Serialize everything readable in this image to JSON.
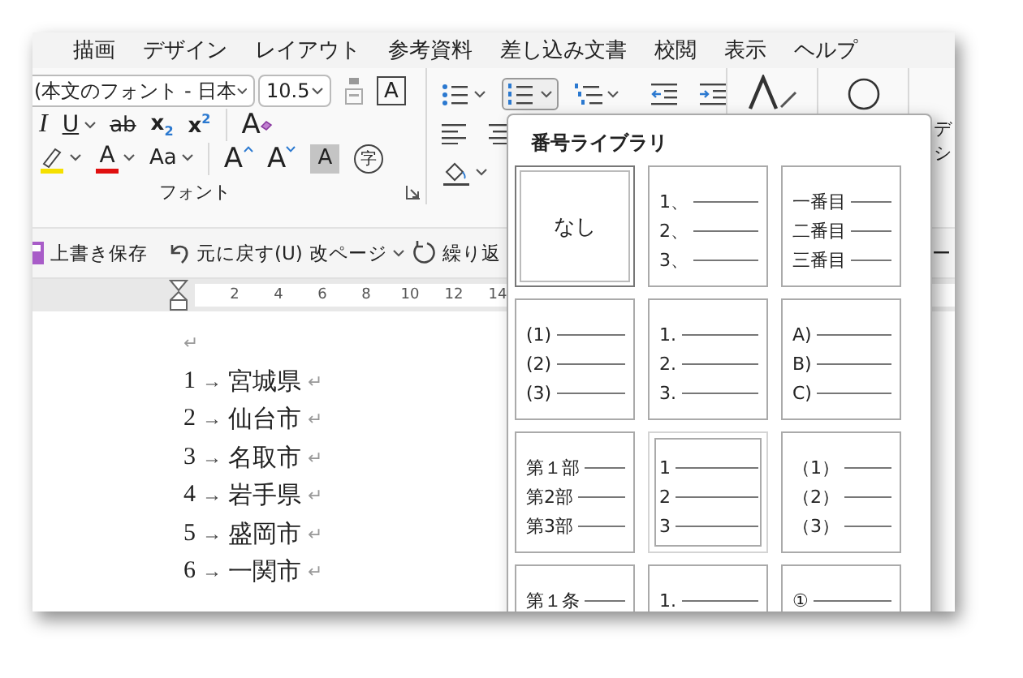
{
  "ribbon": {
    "tabs": [
      {
        "label": "描画"
      },
      {
        "label": "デザイン"
      },
      {
        "label": "レイアウト"
      },
      {
        "label": "参考資料"
      },
      {
        "label": "差し込み文書"
      },
      {
        "label": "校閲"
      },
      {
        "label": "表示"
      },
      {
        "label": "ヘルプ"
      }
    ],
    "font_group": {
      "label": "フォント",
      "font_name": "(本文のフォント - 日本",
      "font_size": "10.5",
      "row_1": [
        {
          "kind": "phonetic"
        },
        {
          "kind": "boxed",
          "glyph": "A"
        }
      ],
      "row_2": [
        {
          "kind": "italic",
          "glyph": "I"
        },
        {
          "kind": "underline",
          "glyph": "U",
          "dropdown": true
        },
        {
          "kind": "strike",
          "glyph": "ab"
        },
        {
          "kind": "script",
          "glyph": "x$_{2}$"
        },
        {
          "kind": "script",
          "glyph": "x$^{2}$"
        },
        {
          "kind": "separator"
        },
        {
          "kind": "clear",
          "glyph": "A"
        }
      ],
      "row_3": [
        {
          "kind": "highlight",
          "dropdown": true
        },
        {
          "kind": "font-color",
          "glyph": "A",
          "dropdown": true
        },
        {
          "kind": "case",
          "glyph": "Aa",
          "dropdown": true
        },
        {
          "kind": "separator"
        },
        {
          "kind": "grow",
          "glyph": "A"
        },
        {
          "kind": "shrink",
          "glyph": "A"
        },
        {
          "kind": "shaded",
          "glyph": "A"
        },
        {
          "kind": "enclosed",
          "glyph": "字"
        }
      ]
    },
    "paragraph_group": {
      "row_1": [
        {
          "kind": "bullets",
          "dropdown": true,
          "active": false
        },
        {
          "kind": "numbering",
          "dropdown": true,
          "active": true
        },
        {
          "kind": "multilevel",
          "dropdown": true,
          "active": false
        },
        {
          "kind": "outdent",
          "dropdown": false,
          "active": false
        },
        {
          "kind": "indent",
          "dropdown": false,
          "active": false
        }
      ],
      "row_2": [
        {
          "kind": "align-left",
          "dropdown": false,
          "active": false
        },
        {
          "kind": "align-center",
          "dropdown": false,
          "active": false
        }
      ],
      "row_3": [
        {
          "kind": "shading",
          "dropdown": true,
          "active": false
        }
      ]
    },
    "cut_labels": [
      "デ",
      "シ"
    ]
  },
  "quick_access": {
    "save_label": "上書き保存",
    "undo_label": "元に戻す(U)",
    "page_break_label": "改ページ",
    "redo_label": "繰り返",
    "cut_label": "ー"
  },
  "ruler": {
    "ticks": [
      "2",
      "4",
      "6",
      "8",
      "10",
      "12",
      "14"
    ]
  },
  "document": {
    "empty_paragraph_mark": "↵",
    "items": [
      {
        "number": "1",
        "tab_mark": "→",
        "text": "宮城県",
        "paragraph_mark": "↵"
      },
      {
        "number": "2",
        "tab_mark": "→",
        "text": "仙台市",
        "paragraph_mark": "↵"
      },
      {
        "number": "3",
        "tab_mark": "→",
        "text": "名取市",
        "paragraph_mark": "↵"
      },
      {
        "number": "4",
        "tab_mark": "→",
        "text": "岩手県",
        "paragraph_mark": "↵"
      },
      {
        "number": "5",
        "tab_mark": "→",
        "text": "盛岡市",
        "paragraph_mark": "↵"
      },
      {
        "number": "6",
        "tab_mark": "→",
        "text": "一関市",
        "paragraph_mark": "↵"
      }
    ]
  },
  "numbering_library": {
    "title": "番号ライブラリ",
    "styles": [
      {
        "kind": "none",
        "label": "なし",
        "selected": true,
        "hovered": false
      },
      {
        "kind": "list",
        "lines": [
          "1、",
          "2、",
          "3、"
        ],
        "selected": false,
        "hovered": false
      },
      {
        "kind": "list",
        "lines": [
          "一番目",
          "二番目",
          "三番目"
        ],
        "selected": false,
        "hovered": false
      },
      {
        "kind": "list",
        "lines": [
          "(1)",
          "(2)",
          "(3)"
        ],
        "selected": false,
        "hovered": false
      },
      {
        "kind": "list",
        "lines": [
          "1.",
          "2.",
          "3."
        ],
        "selected": false,
        "hovered": false
      },
      {
        "kind": "list",
        "lines": [
          "A)",
          "B)",
          "C)"
        ],
        "selected": false,
        "hovered": false
      },
      {
        "kind": "list",
        "lines": [
          "第１部",
          "第2部",
          "第3部"
        ],
        "selected": false,
        "hovered": false
      },
      {
        "kind": "list",
        "lines": [
          "1",
          "2",
          "3"
        ],
        "selected": false,
        "hovered": true
      },
      {
        "kind": "list",
        "lines": [
          "（1）",
          "（2）",
          "（3）"
        ],
        "selected": false,
        "hovered": false
      },
      {
        "kind": "list",
        "lines": [
          "第１条"
        ],
        "selected": false,
        "hovered": false
      },
      {
        "kind": "list",
        "lines": [
          "1."
        ],
        "selected": false,
        "hovered": false
      },
      {
        "kind": "list",
        "lines": [
          "①"
        ],
        "selected": false,
        "hovered": false
      }
    ]
  }
}
